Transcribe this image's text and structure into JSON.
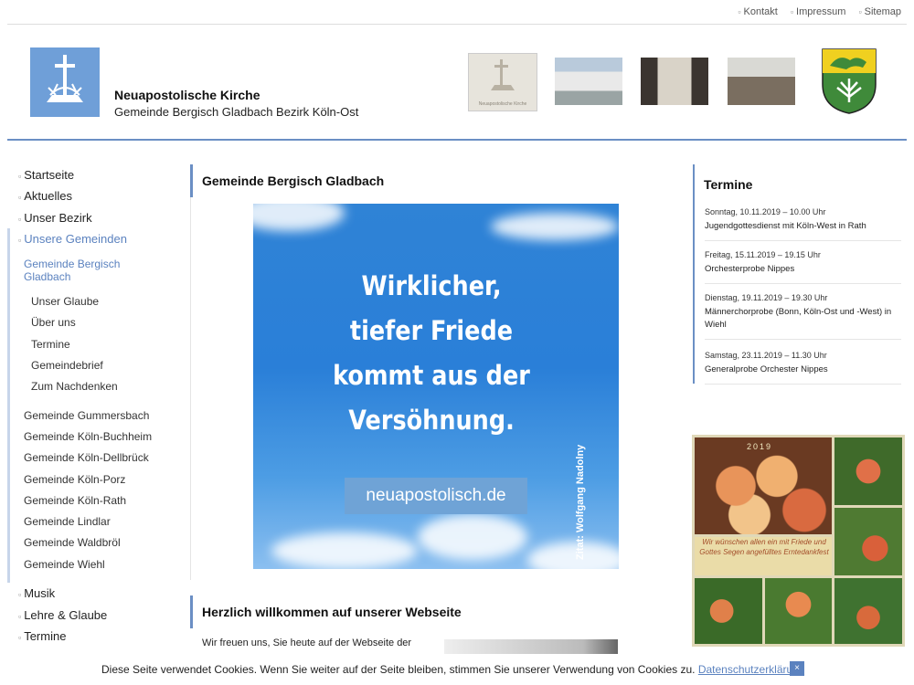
{
  "toplinks": [
    "Kontakt",
    "Impressum",
    "Sitemap"
  ],
  "brand": {
    "name": "Neuapostolische Kirche",
    "subtitle": "Gemeinde Bergisch Gladbach Bezirk Köln-Ost"
  },
  "header_images": {
    "thumb1_caption": "Neuapostolische Kirche"
  },
  "colors": {
    "accent": "#6b8fc4",
    "logo_bg": "#6f9fd8",
    "link": "#5b82bf"
  },
  "nav": {
    "top": [
      "Startseite",
      "Aktuelles",
      "Unser Bezirk",
      "Unsere Gemeinden"
    ],
    "current": "Gemeinde Bergisch Gladbach",
    "sub": [
      "Unser Glaube",
      "Über uns",
      "Termine",
      "Gemeindebrief",
      "Zum Nachdenken"
    ],
    "gemeinden": [
      "Gemeinde Gummersbach",
      "Gemeinde Köln-Buchheim",
      "Gemeinde Köln-Dellbrück",
      "Gemeinde Köln-Porz",
      "Gemeinde Köln-Rath",
      "Gemeinde Lindlar",
      "Gemeinde Waldbröl",
      "Gemeinde Wiehl"
    ],
    "bottom": [
      "Musik",
      "Lehre & Glaube",
      "Termine"
    ]
  },
  "main": {
    "title": "Gemeinde Bergisch Gladbach",
    "banner": {
      "lines": [
        "Wirklicher,",
        "tiefer Friede",
        "kommt aus der",
        "Versöhnung."
      ],
      "button": "neuapostolisch.de",
      "author": "Zitat: Wolfgang Nadolny"
    },
    "welcome_title": "Herzlich willkommen auf unserer Webseite",
    "welcome_text": "Wir freuen uns, Sie heute auf der Webseite der"
  },
  "termine": {
    "title": "Termine",
    "events": [
      {
        "date": "Sonntag, 10.11.2019 – 10.00 Uhr",
        "title": "Jugendgottesdienst mit Köln-West in Rath"
      },
      {
        "date": "Freitag, 15.11.2019 – 19.15 Uhr",
        "title": "Orchesterprobe Nippes"
      },
      {
        "date": "Dienstag, 19.11.2019 – 19.30 Uhr",
        "title": "Männerchorprobe (Bonn, Köln-Ost und -West) in Wiehl"
      },
      {
        "date": "Samstag, 23.11.2019 – 11.30 Uhr",
        "title": "Generalprobe Orchester Nippes"
      }
    ]
  },
  "collage": {
    "year": "2019",
    "note": "Wir wünschen allen ein mit Friede und Gottes Segen angefülltes Erntedankfest"
  },
  "cookie": {
    "text": "Diese Seite verwendet Cookies. Wenn Sie weiter auf der Seite bleiben, stimmen Sie unserer Verwendung von Cookies zu.",
    "link": "Datenschutzerklärung",
    "close": "×"
  }
}
